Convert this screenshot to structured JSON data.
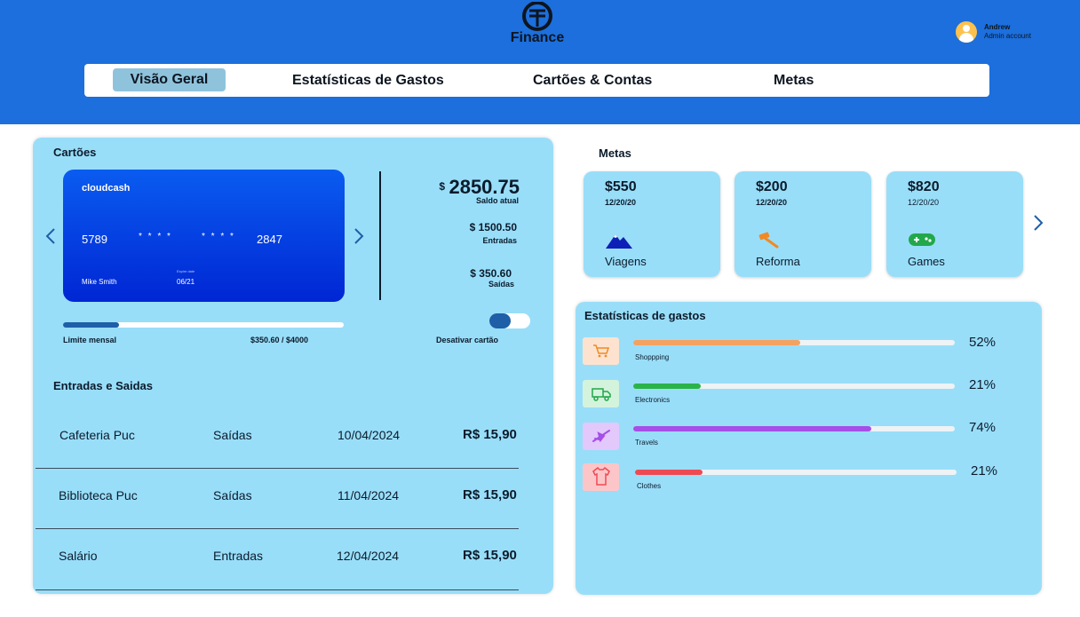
{
  "header": {
    "logo_text": "Finance",
    "user": {
      "name": "Andrew",
      "role": "Admin account"
    }
  },
  "nav": {
    "tabs": [
      {
        "label": "Visão Geral",
        "active": true
      },
      {
        "label": "Estatísticas de  Gastos",
        "active": false
      },
      {
        "label": "Cartões & Contas",
        "active": false
      },
      {
        "label": "Metas",
        "active": false
      }
    ]
  },
  "cards": {
    "title": "Cartões",
    "card": {
      "brand": "cloudcash",
      "number_first": "5789",
      "masked_1": "* * * *",
      "masked_2": "* * * *",
      "number_last": "2847",
      "holder": "Mike Smith",
      "expiry_label": "Expire date",
      "expiry": "06/21"
    },
    "balance": {
      "currency": "$",
      "value": "2850.75",
      "label": "Saldo atual",
      "income_value": "$ 1500.50",
      "income_label": "Entradas",
      "expense_value": "$ 350.60",
      "expense_label": "Saídas"
    },
    "limit": {
      "label": "Limite mensal",
      "value": "$350.60 / $4000",
      "fraction": 0.2
    },
    "toggle_label": "Desativar cartão"
  },
  "transactions": {
    "title": "Entradas e Saidas",
    "rows": [
      {
        "name": "Cafeteria Puc",
        "type": "Saídas",
        "date": "10/04/2024",
        "amount": "R$ 15,90"
      },
      {
        "name": "Biblioteca Puc",
        "type": "Saídas",
        "date": "11/04/2024",
        "amount": "R$ 15,90"
      },
      {
        "name": "Salário",
        "type": "Entradas",
        "date": "12/04/2024",
        "amount": "R$ 15,90"
      }
    ]
  },
  "metas": {
    "title": "Metas",
    "items": [
      {
        "amount": "$550",
        "date": "12/20/20",
        "label": "Viagens",
        "icon": "mountain-icon"
      },
      {
        "amount": "$200",
        "date": "12/20/20",
        "label": "Reforma",
        "icon": "hammer-icon"
      },
      {
        "amount": "$820",
        "date": "12/20/20",
        "label": "Games",
        "icon": "gamepad-icon"
      }
    ]
  },
  "stats": {
    "title": "Estatísticas de gastos",
    "items": [
      {
        "label": "Shoppping",
        "percent": 52,
        "percent_text": "52%",
        "color": "#f4a261",
        "icon": "cart-icon",
        "icon_bg": "#fde3cf"
      },
      {
        "label": "Electronics",
        "percent": 21,
        "percent_text": "21%",
        "color": "#2bb34a",
        "icon": "truck-icon",
        "icon_bg": "#d4f3dc"
      },
      {
        "label": "Travels",
        "percent": 74,
        "percent_text": "74%",
        "color": "#a64ee8",
        "icon": "plane-icon",
        "icon_bg": "#e2c8fb"
      },
      {
        "label": "Clothes",
        "percent": 21,
        "percent_text": "21%",
        "color": "#ee4a53",
        "icon": "shirt-icon",
        "icon_bg": "#fcc6c9"
      }
    ]
  }
}
